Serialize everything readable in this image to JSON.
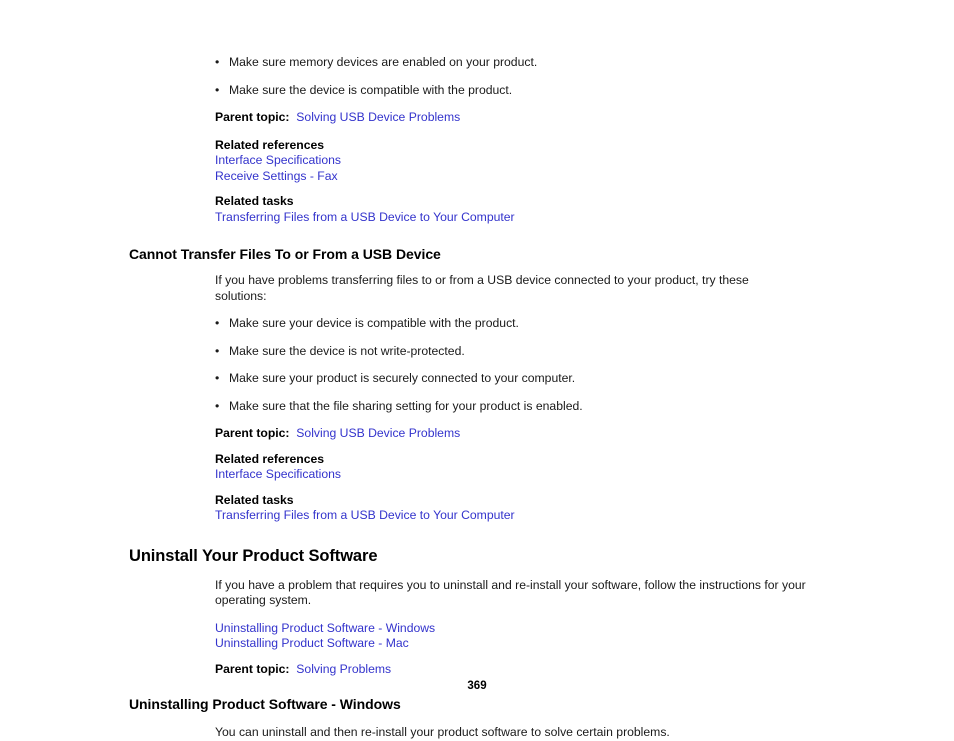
{
  "page": {
    "number": "369",
    "bullet_glyph": "•"
  },
  "sections": [
    {
      "id": "cannot-view-usb",
      "bullets": [
        "Make sure memory devices are enabled on your product.",
        "Make sure the device is compatible with the product."
      ],
      "parent_topic": {
        "label": "Parent topic:",
        "link": "Solving USB Device Problems"
      },
      "related_references": {
        "label": "Related references",
        "links": [
          "Interface Specifications",
          "Receive Settings - Fax"
        ]
      },
      "related_tasks": {
        "label": "Related tasks",
        "links": [
          "Transferring Files from a USB Device to Your Computer"
        ]
      }
    },
    {
      "id": "cannot-transfer-files",
      "heading": "Cannot Transfer Files To or From a USB Device",
      "intro": "If you have problems transferring files to or from a USB device connected to your product, try these solutions:",
      "bullets": [
        "Make sure your device is compatible with the product.",
        "Make sure the device is not write-protected.",
        "Make sure your product is securely connected to your computer.",
        "Make sure that the file sharing setting for your product is enabled."
      ],
      "parent_topic": {
        "label": "Parent topic:",
        "link": "Solving USB Device Problems"
      },
      "related_references": {
        "label": "Related references",
        "links": [
          "Interface Specifications"
        ]
      },
      "related_tasks": {
        "label": "Related tasks",
        "links": [
          "Transferring Files from a USB Device to Your Computer"
        ]
      }
    },
    {
      "id": "uninstall-your-product-software",
      "heading": "Uninstall Your Product Software",
      "intro": "If you have a problem that requires you to uninstall and re-install your software, follow the instructions for your operating system.",
      "child_links": [
        "Uninstalling Product Software - Windows",
        "Uninstalling Product Software - Mac"
      ],
      "parent_topic": {
        "label": "Parent topic:",
        "link": "Solving Problems"
      }
    },
    {
      "id": "uninstalling-product-software-windows",
      "heading": "Uninstalling Product Software - Windows",
      "intro": "You can uninstall and then re-install your product software to solve certain problems."
    }
  ],
  "colors": {
    "link": "#3333cc",
    "text": "#1a1a1a",
    "heading": "#000000",
    "background": "#ffffff"
  }
}
